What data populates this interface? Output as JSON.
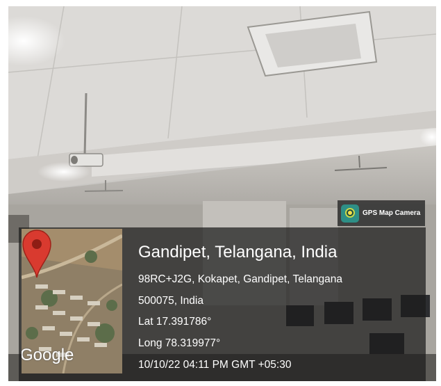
{
  "app_badge": {
    "label": "GPS Map Camera",
    "icon": "gps-map-camera-icon"
  },
  "location": {
    "headline": "Gandipet, Telangana, India",
    "address_line_1": "98RC+J2G, Kokapet, Gandipet, Telangana",
    "address_line_2": "500075, India",
    "latitude": "Lat 17.391786°",
    "longitude": "Long 78.319977°",
    "timestamp": "10/10/22 04:11 PM GMT +05:30"
  },
  "map": {
    "watermark": "Google",
    "pin_color": "#d93a2f",
    "pin_icon": "map-pin-icon"
  },
  "colors": {
    "stamp_background": "#1c1c1c",
    "text": "#ffffff"
  }
}
